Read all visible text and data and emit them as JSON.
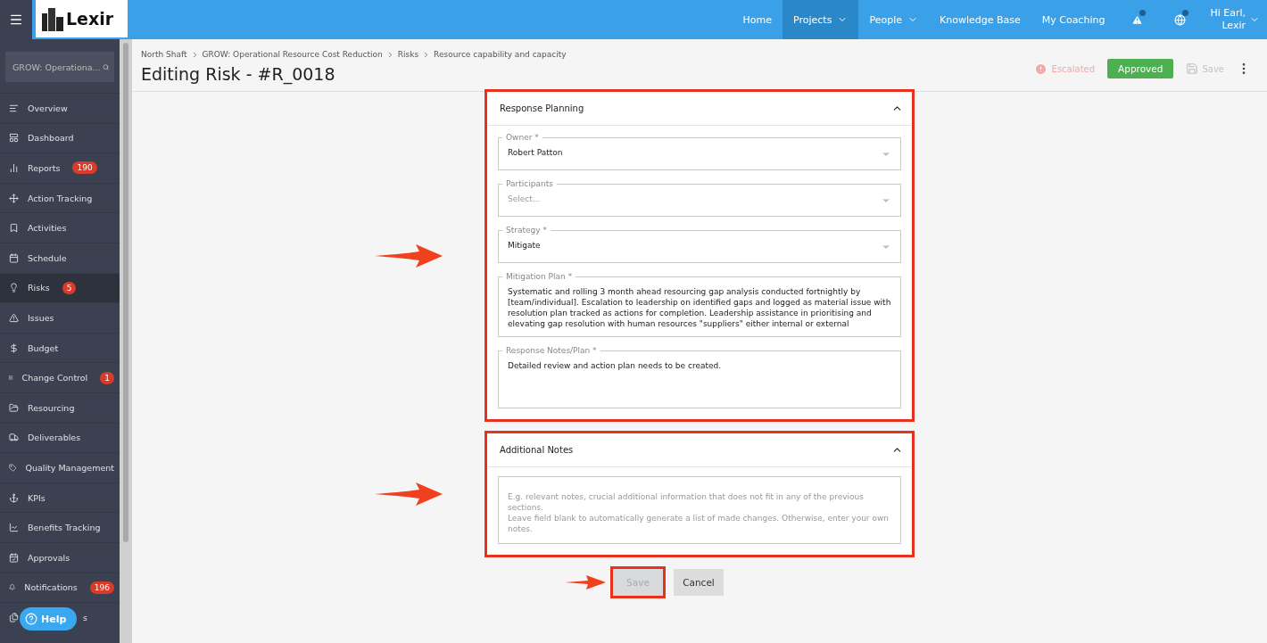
{
  "logo": {
    "text": "Lexir"
  },
  "nav": [
    {
      "label": "Home",
      "selected": false,
      "dropdown": false
    },
    {
      "label": "Projects",
      "selected": true,
      "dropdown": true
    },
    {
      "label": "People",
      "selected": false,
      "dropdown": true
    },
    {
      "label": "Knowledge Base",
      "selected": false,
      "dropdown": false
    },
    {
      "label": "My Coaching",
      "selected": false,
      "dropdown": false
    }
  ],
  "user": {
    "greeting": "Hi Earl,",
    "name": "Lexir"
  },
  "sidebar": {
    "search": {
      "value": "GROW: Operationa..."
    },
    "items": [
      {
        "label": "Overview",
        "selected": false
      },
      {
        "label": "Dashboard",
        "selected": false
      },
      {
        "label": "Reports",
        "selected": false,
        "badge": "190"
      },
      {
        "label": "Action Tracking",
        "selected": false
      },
      {
        "label": "Activities",
        "selected": false
      },
      {
        "label": "Schedule",
        "selected": false
      },
      {
        "label": "Risks",
        "selected": true,
        "badge": "5"
      },
      {
        "label": "Issues",
        "selected": false
      },
      {
        "label": "Budget",
        "selected": false
      },
      {
        "label": "Change Control",
        "selected": false,
        "badge": "1"
      },
      {
        "label": "Resourcing",
        "selected": false
      },
      {
        "label": "Deliverables",
        "selected": false
      },
      {
        "label": "Quality Management",
        "selected": false
      },
      {
        "label": "KPIs",
        "selected": false
      },
      {
        "label": "Benefits Tracking",
        "selected": false
      },
      {
        "label": "Approvals",
        "selected": false
      },
      {
        "label": "Notifications",
        "selected": false,
        "badge": "196"
      },
      {
        "label": "s",
        "selected": false,
        "covered": true
      }
    ],
    "help": "Help"
  },
  "breadcrumb": [
    "North Shaft",
    "GROW: Operational Resource Cost Reduction",
    "Risks",
    "Resource capability and capacity"
  ],
  "page_title": "Editing Risk - #R_0018",
  "status": {
    "escalated": "Escalated",
    "approved": "Approved",
    "save": "Save",
    "save_disabled": true
  },
  "sections": [
    {
      "title": "Response Planning",
      "expanded": true,
      "highlighted": true,
      "fields": [
        {
          "kind": "select",
          "label": "Owner *",
          "value": "Robert Patton"
        },
        {
          "kind": "select",
          "label": "Participants",
          "placeholder": "Select..."
        },
        {
          "kind": "select",
          "label": "Strategy *",
          "value": "Mitigate"
        },
        {
          "kind": "textarea",
          "label": "Mitigation Plan *",
          "value": "Systematic and rolling 3 month ahead resourcing gap analysis conducted fortnightly by [team/individual].  Escalation to leadership on identified gaps and logged as material issue with resolution plan tracked as actions for completion. Leadership assistance in prioritising and elevating gap resolution with human resources \"suppliers\" either internal or external"
        },
        {
          "kind": "textarea",
          "label": "Response Notes/Plan *",
          "value": "Detailed review and action plan needs to be created."
        }
      ]
    },
    {
      "title": "Additional Notes",
      "expanded": true,
      "highlighted": true,
      "fields": [
        {
          "kind": "textarea",
          "placeholder": "E.g. relevant notes, crucial additional information that does not fit in any of the previous sections.\nLeave field blank to automatically generate a list of made changes. Otherwise, enter your own notes."
        }
      ]
    }
  ],
  "actions": [
    {
      "label": "Save",
      "disabled": true,
      "highlighted": true
    },
    {
      "label": "Cancel",
      "disabled": false,
      "highlighted": false
    }
  ]
}
